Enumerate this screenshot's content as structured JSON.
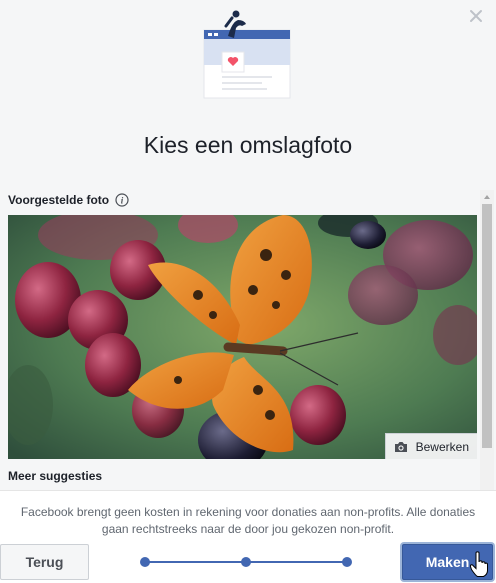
{
  "dialog": {
    "title": "Kies een omslagfoto",
    "close_icon": "close-icon"
  },
  "suggested": {
    "label": "Voorgestelde foto",
    "info_icon": "info-icon",
    "edit_label": "Bewerken",
    "edit_icon": "camera-icon"
  },
  "more": {
    "label": "Meer suggesties"
  },
  "footer": {
    "note": "Facebook brengt geen kosten in rekening voor donaties aan non-profits. Alle donaties gaan rechtstreeks naar de door jou gekozen non-profit.",
    "back_label": "Terug",
    "make_label": "Maken",
    "steps_total": 3,
    "steps_completed": 3
  },
  "colors": {
    "primary": "#4267b2",
    "text": "#1d2129",
    "muted": "#606770"
  }
}
